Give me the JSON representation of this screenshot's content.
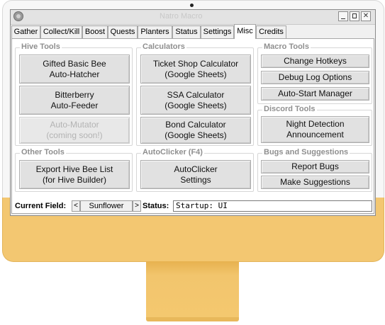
{
  "window": {
    "title": "Natro Macro"
  },
  "tabs": [
    {
      "label": "Gather"
    },
    {
      "label": "Collect/Kill"
    },
    {
      "label": "Boost"
    },
    {
      "label": "Quests"
    },
    {
      "label": "Planters"
    },
    {
      "label": "Status"
    },
    {
      "label": "Settings"
    },
    {
      "label": "Misc",
      "active": true
    },
    {
      "label": "Credits"
    }
  ],
  "hive_tools": {
    "title": "Hive Tools",
    "buttons": [
      {
        "label": "Gifted Basic Bee\nAuto-Hatcher",
        "enabled": true
      },
      {
        "label": "Bitterberry\nAuto-Feeder",
        "enabled": true
      },
      {
        "label": "Auto-Mutator\n(coming soon!)",
        "enabled": false
      }
    ]
  },
  "calculators": {
    "title": "Calculators",
    "buttons": [
      {
        "label": "Ticket Shop Calculator\n(Google Sheets)"
      },
      {
        "label": "SSA Calculator\n(Google Sheets)"
      },
      {
        "label": "Bond Calculator\n(Google Sheets)"
      }
    ]
  },
  "macro_tools": {
    "title": "Macro Tools",
    "buttons": [
      {
        "label": "Change Hotkeys"
      },
      {
        "label": "Debug Log Options"
      },
      {
        "label": "Auto-Start Manager"
      }
    ]
  },
  "discord_tools": {
    "title": "Discord Tools",
    "buttons": [
      {
        "label": "Night Detection\nAnnouncement"
      }
    ]
  },
  "other_tools": {
    "title": "Other Tools",
    "buttons": [
      {
        "label": "Export Hive Bee List\n(for Hive Builder)"
      }
    ]
  },
  "autoclicker": {
    "title": "AutoClicker (F4)",
    "buttons": [
      {
        "label": "AutoClicker\nSettings"
      }
    ]
  },
  "bugs": {
    "title": "Bugs and Suggestions",
    "buttons": [
      {
        "label": "Report Bugs"
      },
      {
        "label": "Make Suggestions"
      }
    ]
  },
  "status_bar": {
    "current_field_label": "Current Field:",
    "prev": "<",
    "field": "Sunflower",
    "next": ">",
    "status_label": "Status:",
    "status_value": "Startup: UI"
  }
}
